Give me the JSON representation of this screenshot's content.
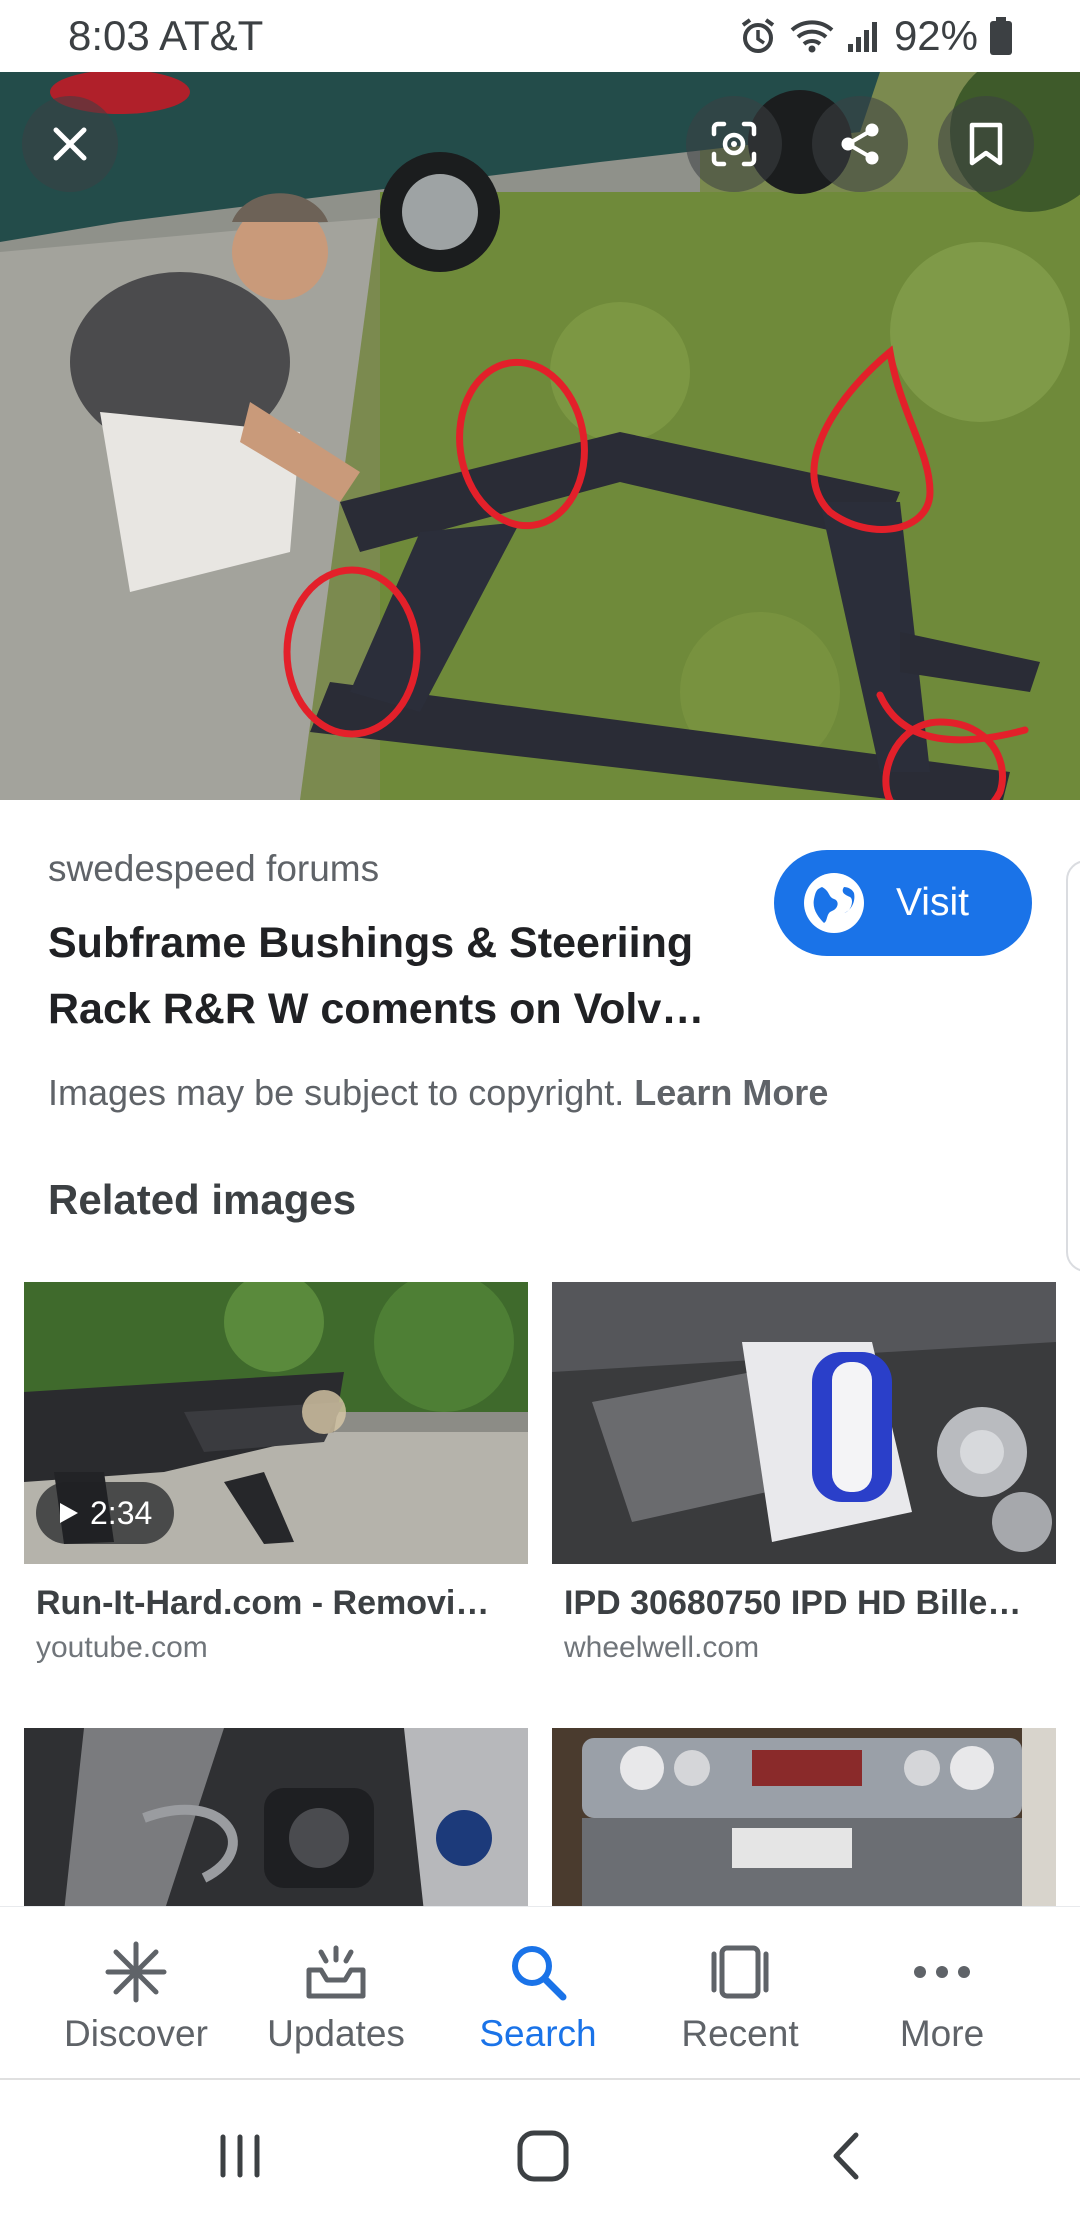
{
  "status_bar": {
    "time_carrier": "8:03 AT&T",
    "battery": "92%"
  },
  "hero": {
    "close_icon": "close-icon",
    "lens_icon": "lens-icon",
    "share_icon": "share-icon",
    "save_icon": "bookmark-icon"
  },
  "result": {
    "source": "swedespeed forums",
    "title": "Subframe Bushings & Steeriing Rack R&R W coments on Volv…",
    "visit_label": "Visit",
    "copyright_text": "Images may be subject to copyright.",
    "learn_more": "Learn More"
  },
  "related": {
    "heading": "Related images",
    "items": [
      {
        "title": "Run-It-Hard.com - Removi…",
        "source": "youtube.com",
        "duration": "2:34"
      },
      {
        "title": "IPD 30680750 IPD HD Bille…",
        "source": "wheelwell.com"
      },
      {
        "title": "",
        "source": ""
      },
      {
        "title": "",
        "source": ""
      }
    ]
  },
  "bottom_nav": {
    "items": [
      {
        "label": "Discover",
        "icon": "asterisk-icon"
      },
      {
        "label": "Updates",
        "icon": "updates-icon"
      },
      {
        "label": "Search",
        "icon": "search-icon",
        "active": true
      },
      {
        "label": "Recent",
        "icon": "recent-icon"
      },
      {
        "label": "More",
        "icon": "more-icon"
      }
    ]
  },
  "colors": {
    "accent": "#1a73e8",
    "annotation_red": "#e3202a"
  }
}
